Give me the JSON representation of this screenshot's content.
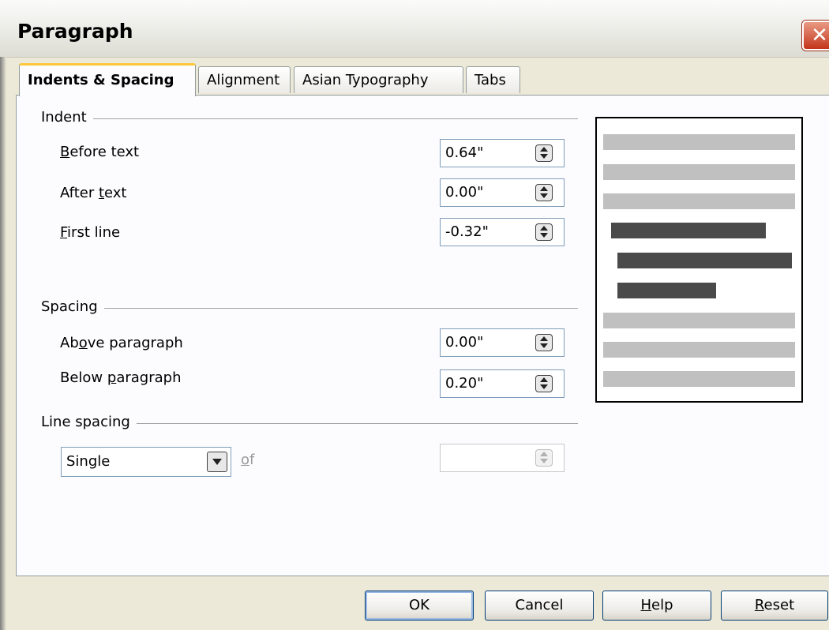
{
  "window": {
    "title": "Paragraph",
    "close_label": "✕"
  },
  "tabs": [
    {
      "label": "Indents & Spacing",
      "active": true
    },
    {
      "label": "Alignment",
      "active": false
    },
    {
      "label": "Asian Typography",
      "active": false
    },
    {
      "label": "Tabs",
      "active": false
    }
  ],
  "indent": {
    "group_label": "Indent",
    "before_text": {
      "label_prefix": "",
      "label_mnemonic": "B",
      "label_rest": "efore text",
      "value": "0.64\""
    },
    "after_text": {
      "label_prefix": "After ",
      "label_mnemonic": "t",
      "label_rest": "ext",
      "value": "0.00\""
    },
    "first_line": {
      "label_prefix": "",
      "label_mnemonic": "F",
      "label_rest": "irst line",
      "value": "-0.32\""
    }
  },
  "spacing": {
    "group_label": "Spacing",
    "above_paragraph": {
      "label_prefix": "Ab",
      "label_mnemonic": "o",
      "label_rest": "ve paragraph",
      "value": "0.00\""
    },
    "below_paragraph": {
      "label_prefix": "Below ",
      "label_mnemonic": "p",
      "label_rest": "aragraph",
      "value": "0.20\""
    }
  },
  "line_spacing": {
    "group_label": "Line spacing",
    "selected": "Single",
    "of_label_mnemonic": "o",
    "of_label_rest": "f",
    "of_value": ""
  },
  "buttons": {
    "ok": "OK",
    "cancel": "Cancel",
    "help_mnemonic": "H",
    "help_rest": "elp",
    "reset_mnemonic": "R",
    "reset_rest": "eset"
  },
  "colors": {
    "dialog_bg": "#ece9d8",
    "panel_bg": "#fcfcfe",
    "active_tab_accent": "#ffc83c",
    "close_button": "#c4341a"
  }
}
